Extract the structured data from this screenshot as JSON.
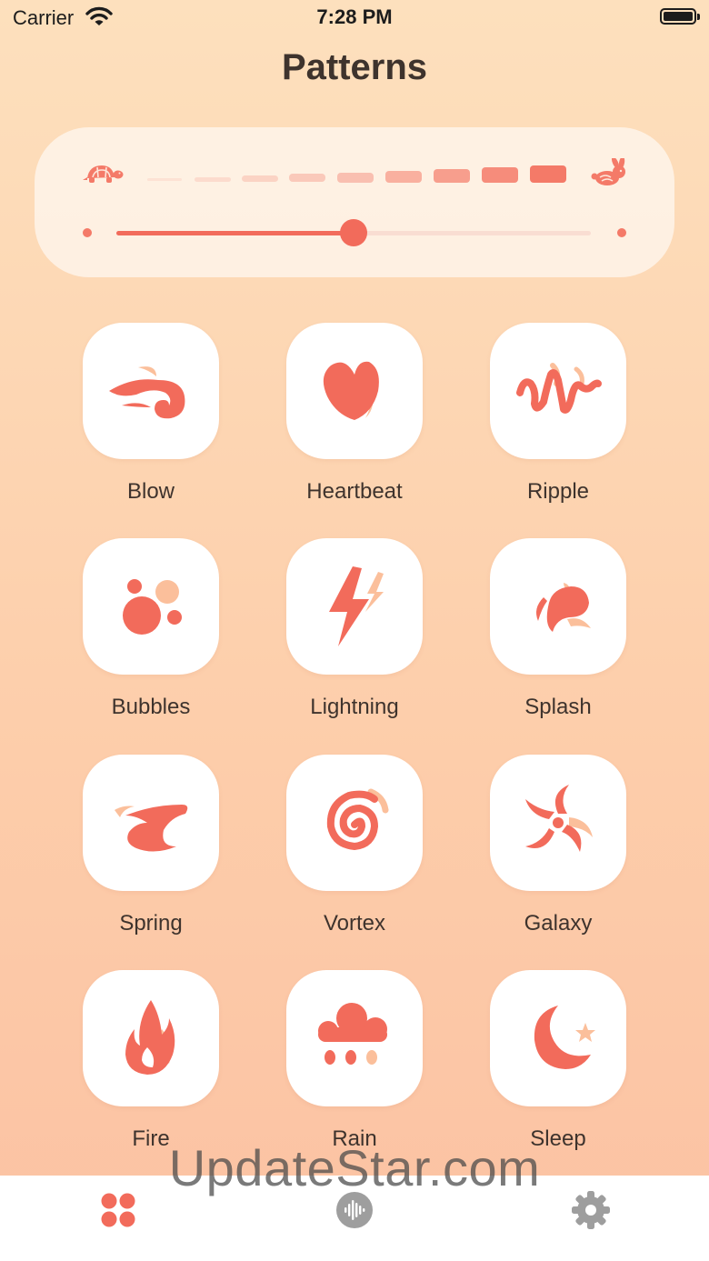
{
  "status": {
    "carrier": "Carrier",
    "time": "7:28 PM"
  },
  "header": {
    "title": "Patterns"
  },
  "speed_control": {
    "slow_icon": "turtle-icon",
    "fast_icon": "rabbit-icon",
    "level": 0.5
  },
  "patterns": [
    {
      "label": "Blow",
      "icon": "blow-icon"
    },
    {
      "label": "Heartbeat",
      "icon": "heartbeat-icon"
    },
    {
      "label": "Ripple",
      "icon": "ripple-icon"
    },
    {
      "label": "Bubbles",
      "icon": "bubbles-icon"
    },
    {
      "label": "Lightning",
      "icon": "lightning-icon"
    },
    {
      "label": "Splash",
      "icon": "splash-icon"
    },
    {
      "label": "Spring",
      "icon": "spring-icon"
    },
    {
      "label": "Vortex",
      "icon": "vortex-icon"
    },
    {
      "label": "Galaxy",
      "icon": "galaxy-icon"
    },
    {
      "label": "Fire",
      "icon": "fire-icon"
    },
    {
      "label": "Rain",
      "icon": "rain-icon"
    },
    {
      "label": "Sleep",
      "icon": "sleep-icon"
    }
  ],
  "tab_bar": {
    "tabs": [
      {
        "icon": "patterns-grid-icon",
        "selected": true
      },
      {
        "icon": "sound-wave-icon",
        "selected": false
      },
      {
        "icon": "gear-icon",
        "selected": false
      }
    ]
  },
  "watermark": "UpdateStar.com",
  "colors": {
    "accent": "#f26b5b",
    "accent_light": "#fbbf9b",
    "inactive": "#9e9e9e"
  }
}
